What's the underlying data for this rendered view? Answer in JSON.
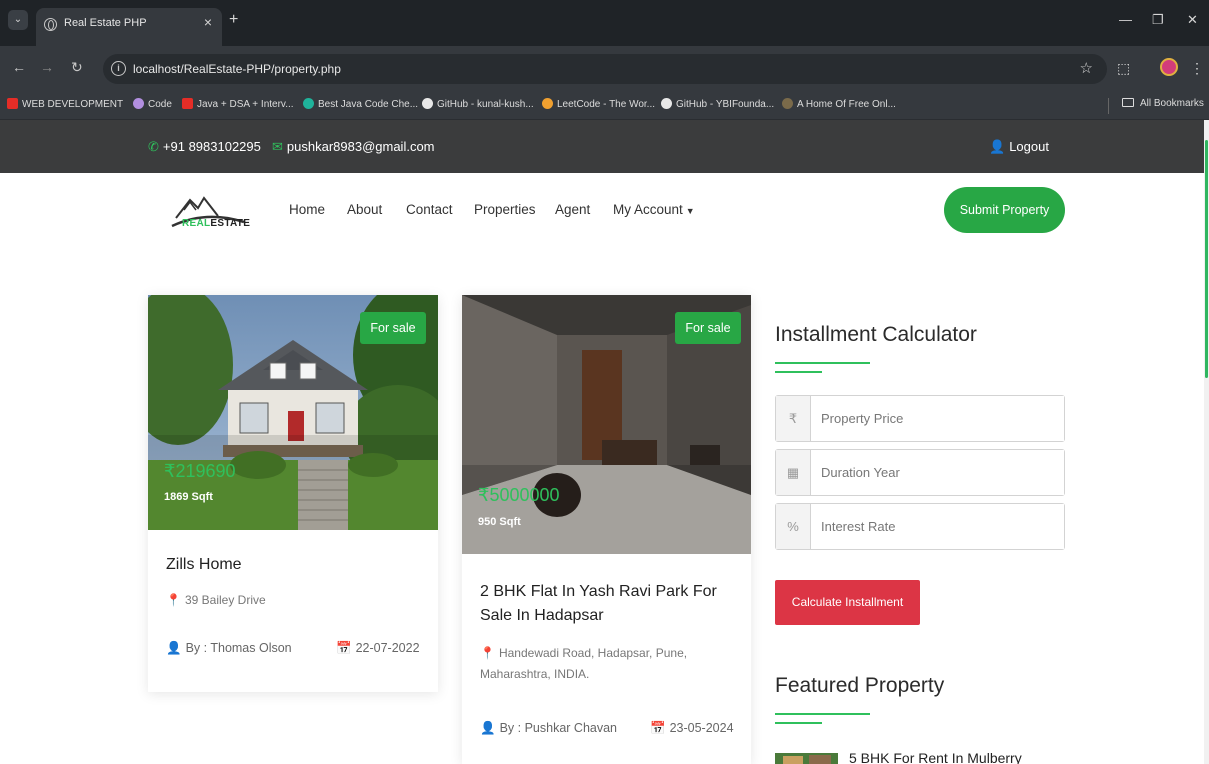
{
  "browser": {
    "tab_title": "Real Estate PHP",
    "tab_close": "×",
    "new_tab": "+",
    "url": "localhost/RealEstate-PHP/property.php",
    "bookmarks": [
      "WEB DEVELOPMENT",
      "Code",
      "Java + DSA + Interv...",
      "Best Java Code Che...",
      "GitHub - kunal-kush...",
      "LeetCode - The Wor...",
      "GitHub - YBIFounda...",
      "A Home Of Free Onl..."
    ],
    "all_bookmarks": "All Bookmarks"
  },
  "topbar": {
    "phone": "+91 8983102295",
    "email": "pushkar8983@gmail.com",
    "logout": "Logout"
  },
  "nav": {
    "logo_text_a": "REAL",
    "logo_text_b": "ESTATE",
    "items": [
      "Home",
      "About",
      "Contact",
      "Properties",
      "Agent",
      "My Account"
    ],
    "submit": "Submit Property"
  },
  "properties": [
    {
      "badge": "For sale",
      "price": "₹219690",
      "sqft": "1869 Sqft",
      "title": "Zills Home",
      "address": "39 Bailey Drive",
      "by": "By : Thomas Olson",
      "date": "22-07-2022"
    },
    {
      "badge": "For sale",
      "price": "₹5000000",
      "sqft": "950 Sqft",
      "title_line1": "2 BHK Flat In Yash Ravi Park For",
      "title_line2": "Sale In Hadapsar",
      "address_line1": "Handewadi Road, Hadapsar, Pune,",
      "address_line2": "Maharashtra, INDIA.",
      "by": "By : Pushkar Chavan",
      "date": "23-05-2024"
    }
  ],
  "calculator": {
    "heading": "Installment Calculator",
    "price_addon": "₹",
    "price_placeholder": "Property Price",
    "duration_placeholder": "Duration Year",
    "rate_addon": "%",
    "rate_placeholder": "Interest Rate",
    "button": "Calculate Installment"
  },
  "featured": {
    "heading": "Featured Property",
    "first_title": "5 BHK For Rent In Mulberry"
  },
  "colors": {
    "accent_green": "#28a745",
    "price_green": "#2fc05c",
    "calc_red": "#dc3545",
    "topbar_bg": "#3b3c3d"
  }
}
